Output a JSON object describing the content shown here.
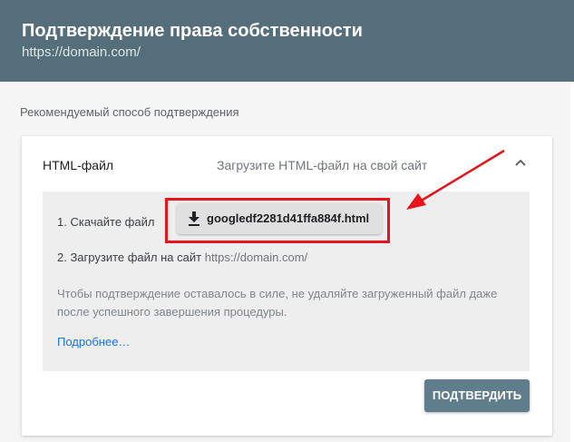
{
  "header": {
    "title": "Подтверждение права собственности",
    "subtitle": "https://domain.com/"
  },
  "main": {
    "section_label": "Рекомендуемый способ подтверждения",
    "card": {
      "title": "HTML-файл",
      "description": "Загрузите HTML-файл на свой сайт",
      "step1_label": "1. Скачайте файл",
      "download_filename": "googledf2281d41ffa884f.html",
      "step2_label": "2. Загрузите файл на сайт",
      "step2_url": "https://domain.com/",
      "note": "Чтобы подтверждение оставалось в силе, не удаляйте загруженный файл даже после успешного завершения процедуры.",
      "more_link": "Подробнее…",
      "confirm_button": "ПОДТВЕРДИТЬ"
    }
  },
  "icons": {
    "collapse": "chevron-up-icon",
    "download": "download-icon"
  },
  "colors": {
    "header_bg": "#546e7a",
    "confirm_bg": "#607d8b",
    "highlight": "#e5141d",
    "link": "#1a73e8"
  }
}
